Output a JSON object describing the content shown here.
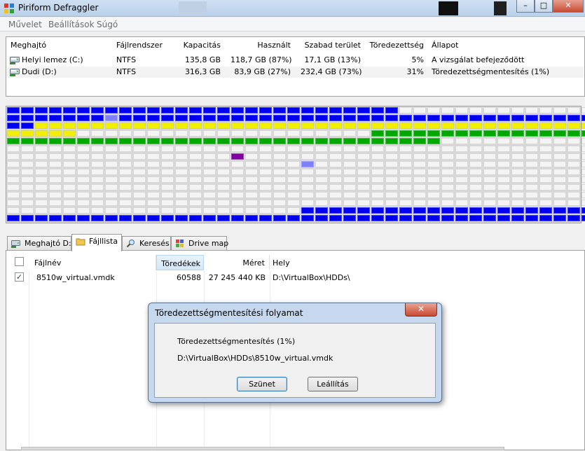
{
  "window": {
    "title": "Piriform Defraggler",
    "controls": {
      "minimize": "–",
      "maximize": "□",
      "close": "✕"
    }
  },
  "menu": [
    "Művelet",
    "Beállítások",
    "Súgó"
  ],
  "drives": {
    "headers": {
      "drive": "Meghajtó",
      "fs": "Fájlrendszer",
      "capacity": "Kapacitás",
      "used": "Használt",
      "free": "Szabad terület",
      "frag": "Töredezettség",
      "status": "Állapot"
    },
    "rows": [
      {
        "drive": "Helyi lemez (C:)",
        "fs": "NTFS",
        "capacity": "135,8 GB",
        "used": "118,7 GB (87%)",
        "free": "17,1 GB (13%)",
        "frag": "5%",
        "status": "A vizsgálat befejeződött"
      },
      {
        "drive": "Dudi (D:)",
        "fs": "NTFS",
        "capacity": "316,3 GB",
        "used": "83,9 GB (27%)",
        "free": "232,4 GB (73%)",
        "frag": "31%",
        "status": "Töredezettségmentesítés (1%)"
      }
    ]
  },
  "disk_map": {
    "colors": {
      "bl": "#0000f0",
      "ye": "#f0f000",
      "gr": "#00a800",
      "fr": "#f4f4f4",
      "lb": "#8080ff",
      "pu": "#8000a0"
    },
    "rows": [
      "bbbbbbbbbbbbbbbbbbbbbbbbbbbbffffffffffffff",
      "bbbbbbblbbbbbbbbbbbbbbbbbbbbbbbbbbbbbbbbbb",
      "bbyyyyyyyyyyyyyyyyyyyyyyyyyyyyyyyyyyyyyyyy",
      "yyyyyfffffffffffffffffffffgggggggggggggggg",
      "gggggggggggggggggggggggggggggggfffffffffff",
      "ffffffffffffffffffffffffffffffffffffffffff",
      "ffffffffffffffffpfffffffffffffffffffffffff",
      "fffffffffffffffffffffLffffffffffffffffffff",
      "ffffffffffffffffffffffffffffffffffffffffff",
      "ffffffffffffffffffffffffffffffffffffffffff",
      "ffffffffffffffffffffffffffffffffffffffffff",
      "ffffffffffffffffffffffffffffffffffffffffff",
      "ffffffffffffffffffffffffffffffffffffffffff",
      "fffffffffffffffffffffbbbbbbbbbbbbbbbbbbbbb",
      "bbbbbbbbbbbbbbbbbbbbbbbbbbbbbbbbbbbbbbbbbb"
    ]
  },
  "tabs": [
    {
      "label": "Meghajtó D:",
      "icon": "drive-icon"
    },
    {
      "label": "Fájllista",
      "icon": "folder-icon"
    },
    {
      "label": "Keresés",
      "icon": "search-icon"
    },
    {
      "label": "Drive map",
      "icon": "drive-map-icon"
    }
  ],
  "filelist": {
    "headers": {
      "name": "Fájlnév",
      "frags": "Töredékek",
      "size": "Méret",
      "path": "Hely"
    },
    "rows": [
      {
        "checked": true,
        "name": "8510w_virtual.vmdk",
        "frags": "60588",
        "size": "27 245 440 KB",
        "path": "D:\\VirtualBox\\HDDs\\"
      }
    ]
  },
  "dialog": {
    "title": "Töredezettségmentesítési folyamat",
    "status": "Töredezettségmentesítés (1%)",
    "file": "D:\\VirtualBox\\HDDs\\8510w_virtual.vmdk",
    "pause_label": "Szünet",
    "stop_label": "Leállítás",
    "close": "✕"
  }
}
